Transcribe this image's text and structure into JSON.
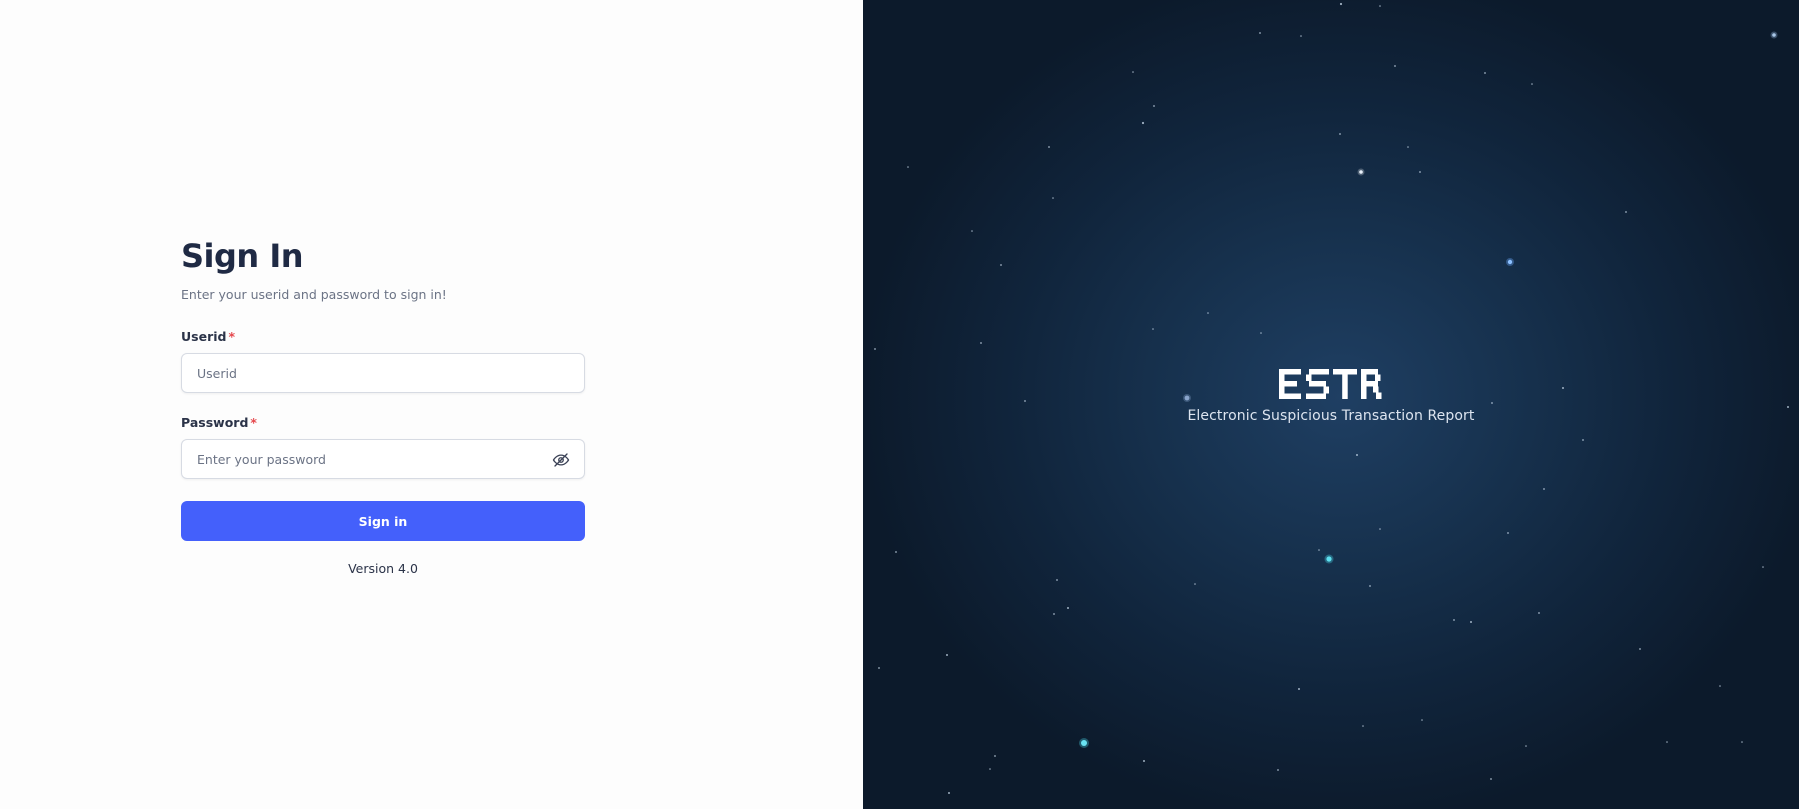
{
  "signin": {
    "title": "Sign In",
    "subtitle": "Enter your userid and password to sign in!",
    "userid_label": "Userid",
    "userid_placeholder": "Userid",
    "password_label": "Password",
    "password_placeholder": "Enter your password",
    "required_mark": "*",
    "submit_label": "Sign in",
    "version": "Version 4.0",
    "password_toggle_icon": "eye-off-icon"
  },
  "brand": {
    "logo_text": "ESTR",
    "tagline": "Electronic Suspicious Transaction Report"
  },
  "colors": {
    "primary": "#4460fb",
    "required": "#e5484d",
    "heading": "#1f2a44",
    "panel_dark": "#0c1a2b",
    "panel_glow": "#1f3f63"
  }
}
